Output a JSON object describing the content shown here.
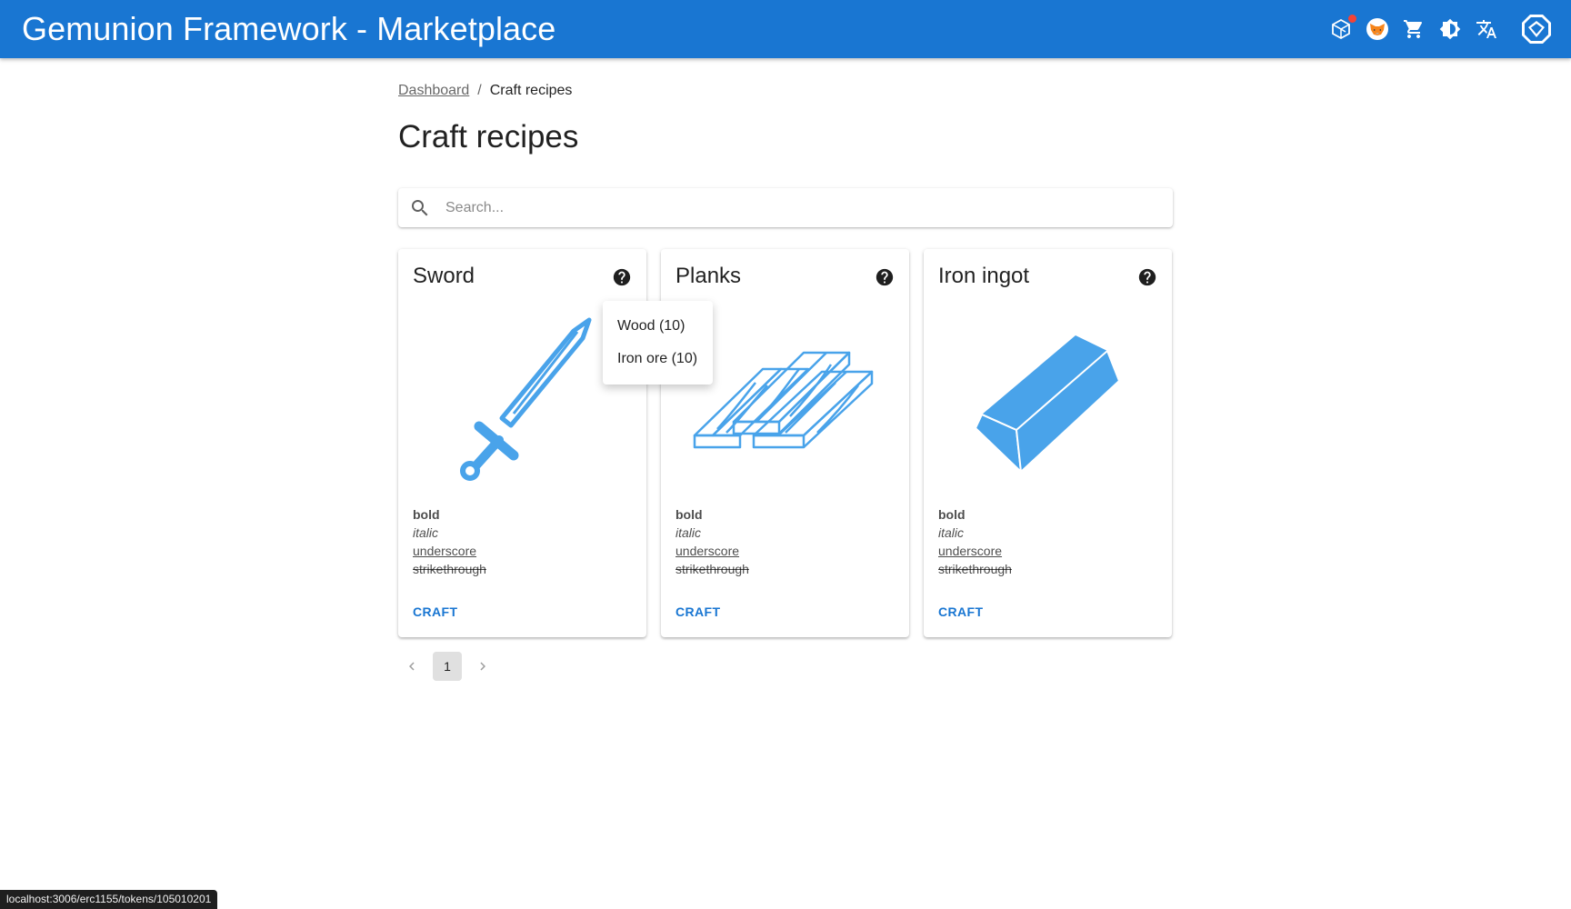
{
  "app": {
    "title": "Gemunion Framework - Marketplace",
    "accent": "#1976d2",
    "icons": [
      "network-icon",
      "metamask-icon",
      "cart-icon",
      "theme-toggle-icon",
      "translate-icon",
      "wallet-avatar-icon"
    ]
  },
  "breadcrumb": {
    "home": "Dashboard",
    "current": "Craft recipes"
  },
  "page": {
    "title": "Craft recipes"
  },
  "search": {
    "placeholder": "Search..."
  },
  "cards": [
    {
      "title": "Sword",
      "image": "sword-icon",
      "desc": {
        "bold": "bold",
        "italic": "italic",
        "underscore": "underscore",
        "strike": "strikethrough"
      },
      "action": "CRAFT"
    },
    {
      "title": "Planks",
      "image": "planks-icon",
      "desc": {
        "bold": "bold",
        "italic": "italic",
        "underscore": "underscore",
        "strike": "strikethrough"
      },
      "action": "CRAFT"
    },
    {
      "title": "Iron ingot",
      "image": "ingot-icon",
      "desc": {
        "bold": "bold",
        "italic": "italic",
        "underscore": "underscore",
        "strike": "strikethrough"
      },
      "action": "CRAFT"
    }
  ],
  "tooltip": {
    "items": [
      "Wood (10)",
      "Iron ore (10)"
    ]
  },
  "pagination": {
    "current": "1"
  },
  "statusbar": {
    "url": "localhost:3006/erc1155/tokens/105010201"
  }
}
